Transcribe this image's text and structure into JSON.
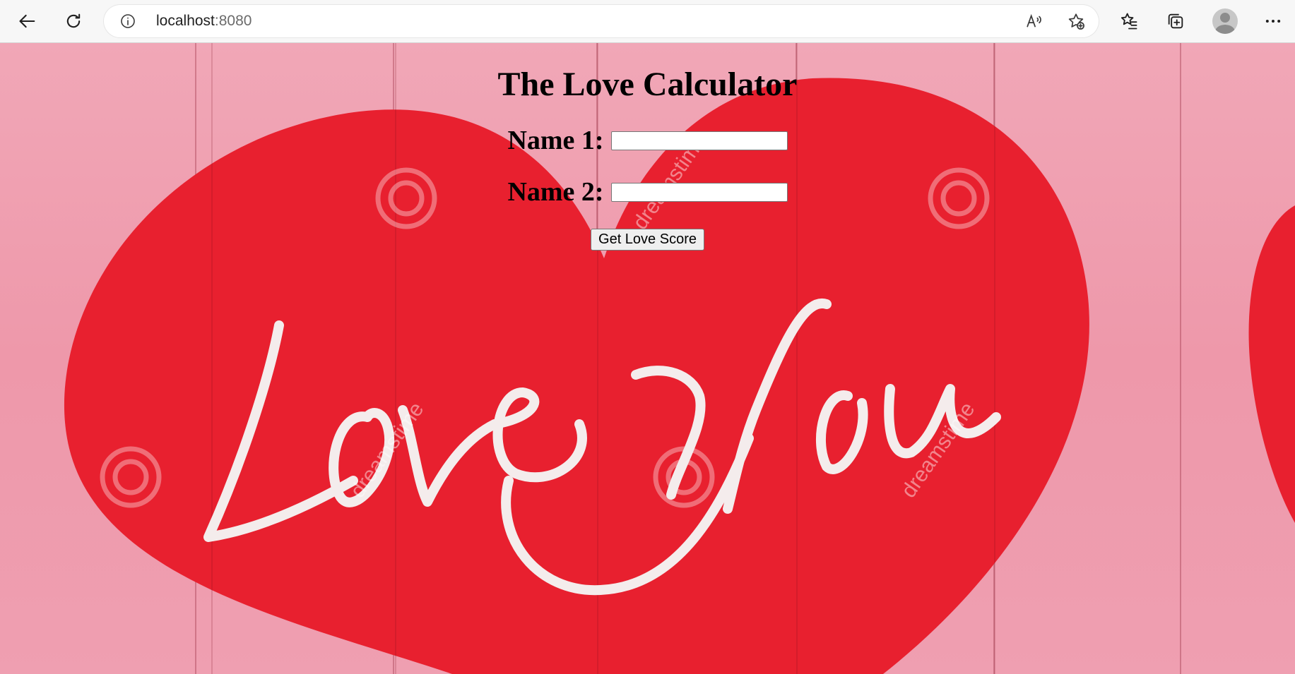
{
  "browser": {
    "url_host": "localhost",
    "url_port": ":8080",
    "icons": [
      "back-arrow-icon",
      "refresh-icon",
      "site-info-icon",
      "read-aloud-icon",
      "add-favorite-icon",
      "favorites-icon",
      "collections-icon",
      "profile-avatar",
      "more-icon"
    ]
  },
  "page": {
    "title": "The Love Calculator",
    "name1_label": "Name 1:",
    "name1_value": "",
    "name2_label": "Name 2:",
    "name2_value": "",
    "submit_label": "Get Love Score",
    "background_text": "Love You",
    "watermark": "dreamstime"
  },
  "colors": {
    "heart": "#e8202f",
    "background_wood": "#ef9fb1",
    "script_text": "#f4ecec"
  }
}
